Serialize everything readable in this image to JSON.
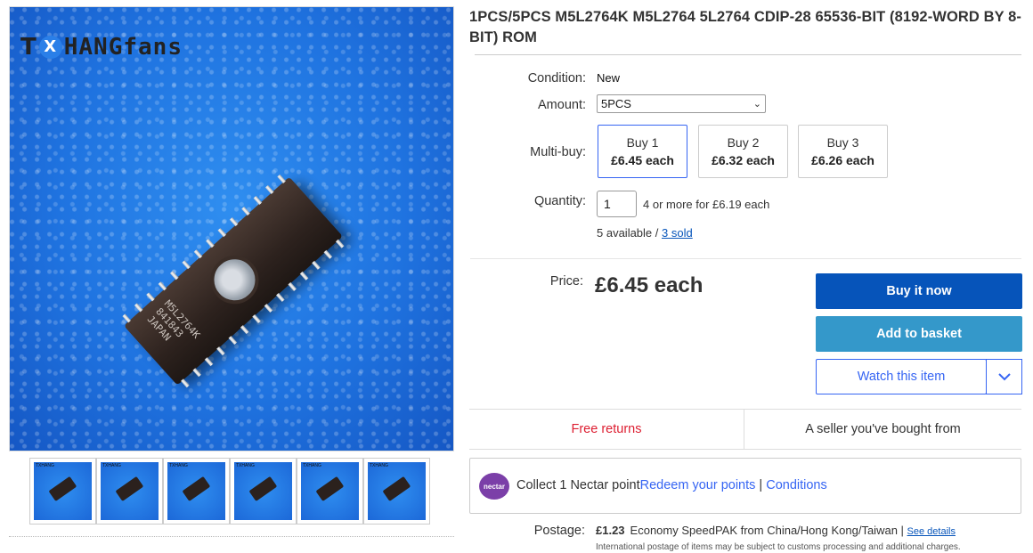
{
  "brand": {
    "logo_prefix": "T",
    "logo_x": "X",
    "logo_suffix": "HANGfans"
  },
  "product": {
    "title": "1PCS/5PCS M5L2764K M5L2764 5L2764 CDIP-28 65536-BIT (8192-WORD BY 8-BIT) ROM",
    "chip_marking": [
      "M5L2764K",
      "841843",
      "JAPAN"
    ]
  },
  "thumbnails": [
    {
      "name": "thumbnail-1"
    },
    {
      "name": "thumbnail-2"
    },
    {
      "name": "thumbnail-3"
    },
    {
      "name": "thumbnail-4"
    },
    {
      "name": "thumbnail-5"
    },
    {
      "name": "thumbnail-6"
    }
  ],
  "details": {
    "condition_label": "Condition:",
    "condition_value": "New",
    "amount_label": "Amount:",
    "amount_value": "5PCS",
    "multibuy_label": "Multi-buy:",
    "multibuy": [
      {
        "qty": "Buy 1",
        "price": "£6.45 each"
      },
      {
        "qty": "Buy 2",
        "price": "£6.32 each"
      },
      {
        "qty": "Buy 3",
        "price": "£6.26 each"
      }
    ],
    "quantity_label": "Quantity:",
    "quantity_value": "1",
    "quantity_note": "4 or more for £6.19 each",
    "available": "5 available /",
    "sold": "3 sold"
  },
  "price": {
    "label": "Price:",
    "value": "£6.45 each"
  },
  "actions": {
    "buy_now": "Buy it now",
    "add_basket": "Add to basket",
    "watch": "Watch this item"
  },
  "info": {
    "free_returns": "Free returns",
    "seller_note": "A seller you've bought from"
  },
  "nectar": {
    "logo_text": "nectar",
    "collect": "Collect 1 Nectar point",
    "redeem": "Redeem your points",
    "separator": " | ",
    "conditions": "Conditions"
  },
  "postage": {
    "label": "Postage:",
    "amount": "£1.23",
    "service": "Economy SpeedPAK from China/Hong Kong/Taiwan | ",
    "details_link": "See details",
    "note": "International postage of items may be subject to customs processing and additional charges."
  },
  "colors": {
    "buy_now_bg": "#0654ba",
    "add_basket_bg": "#3498ca",
    "link": "#3665f3",
    "free_returns": "#dd1e31"
  }
}
